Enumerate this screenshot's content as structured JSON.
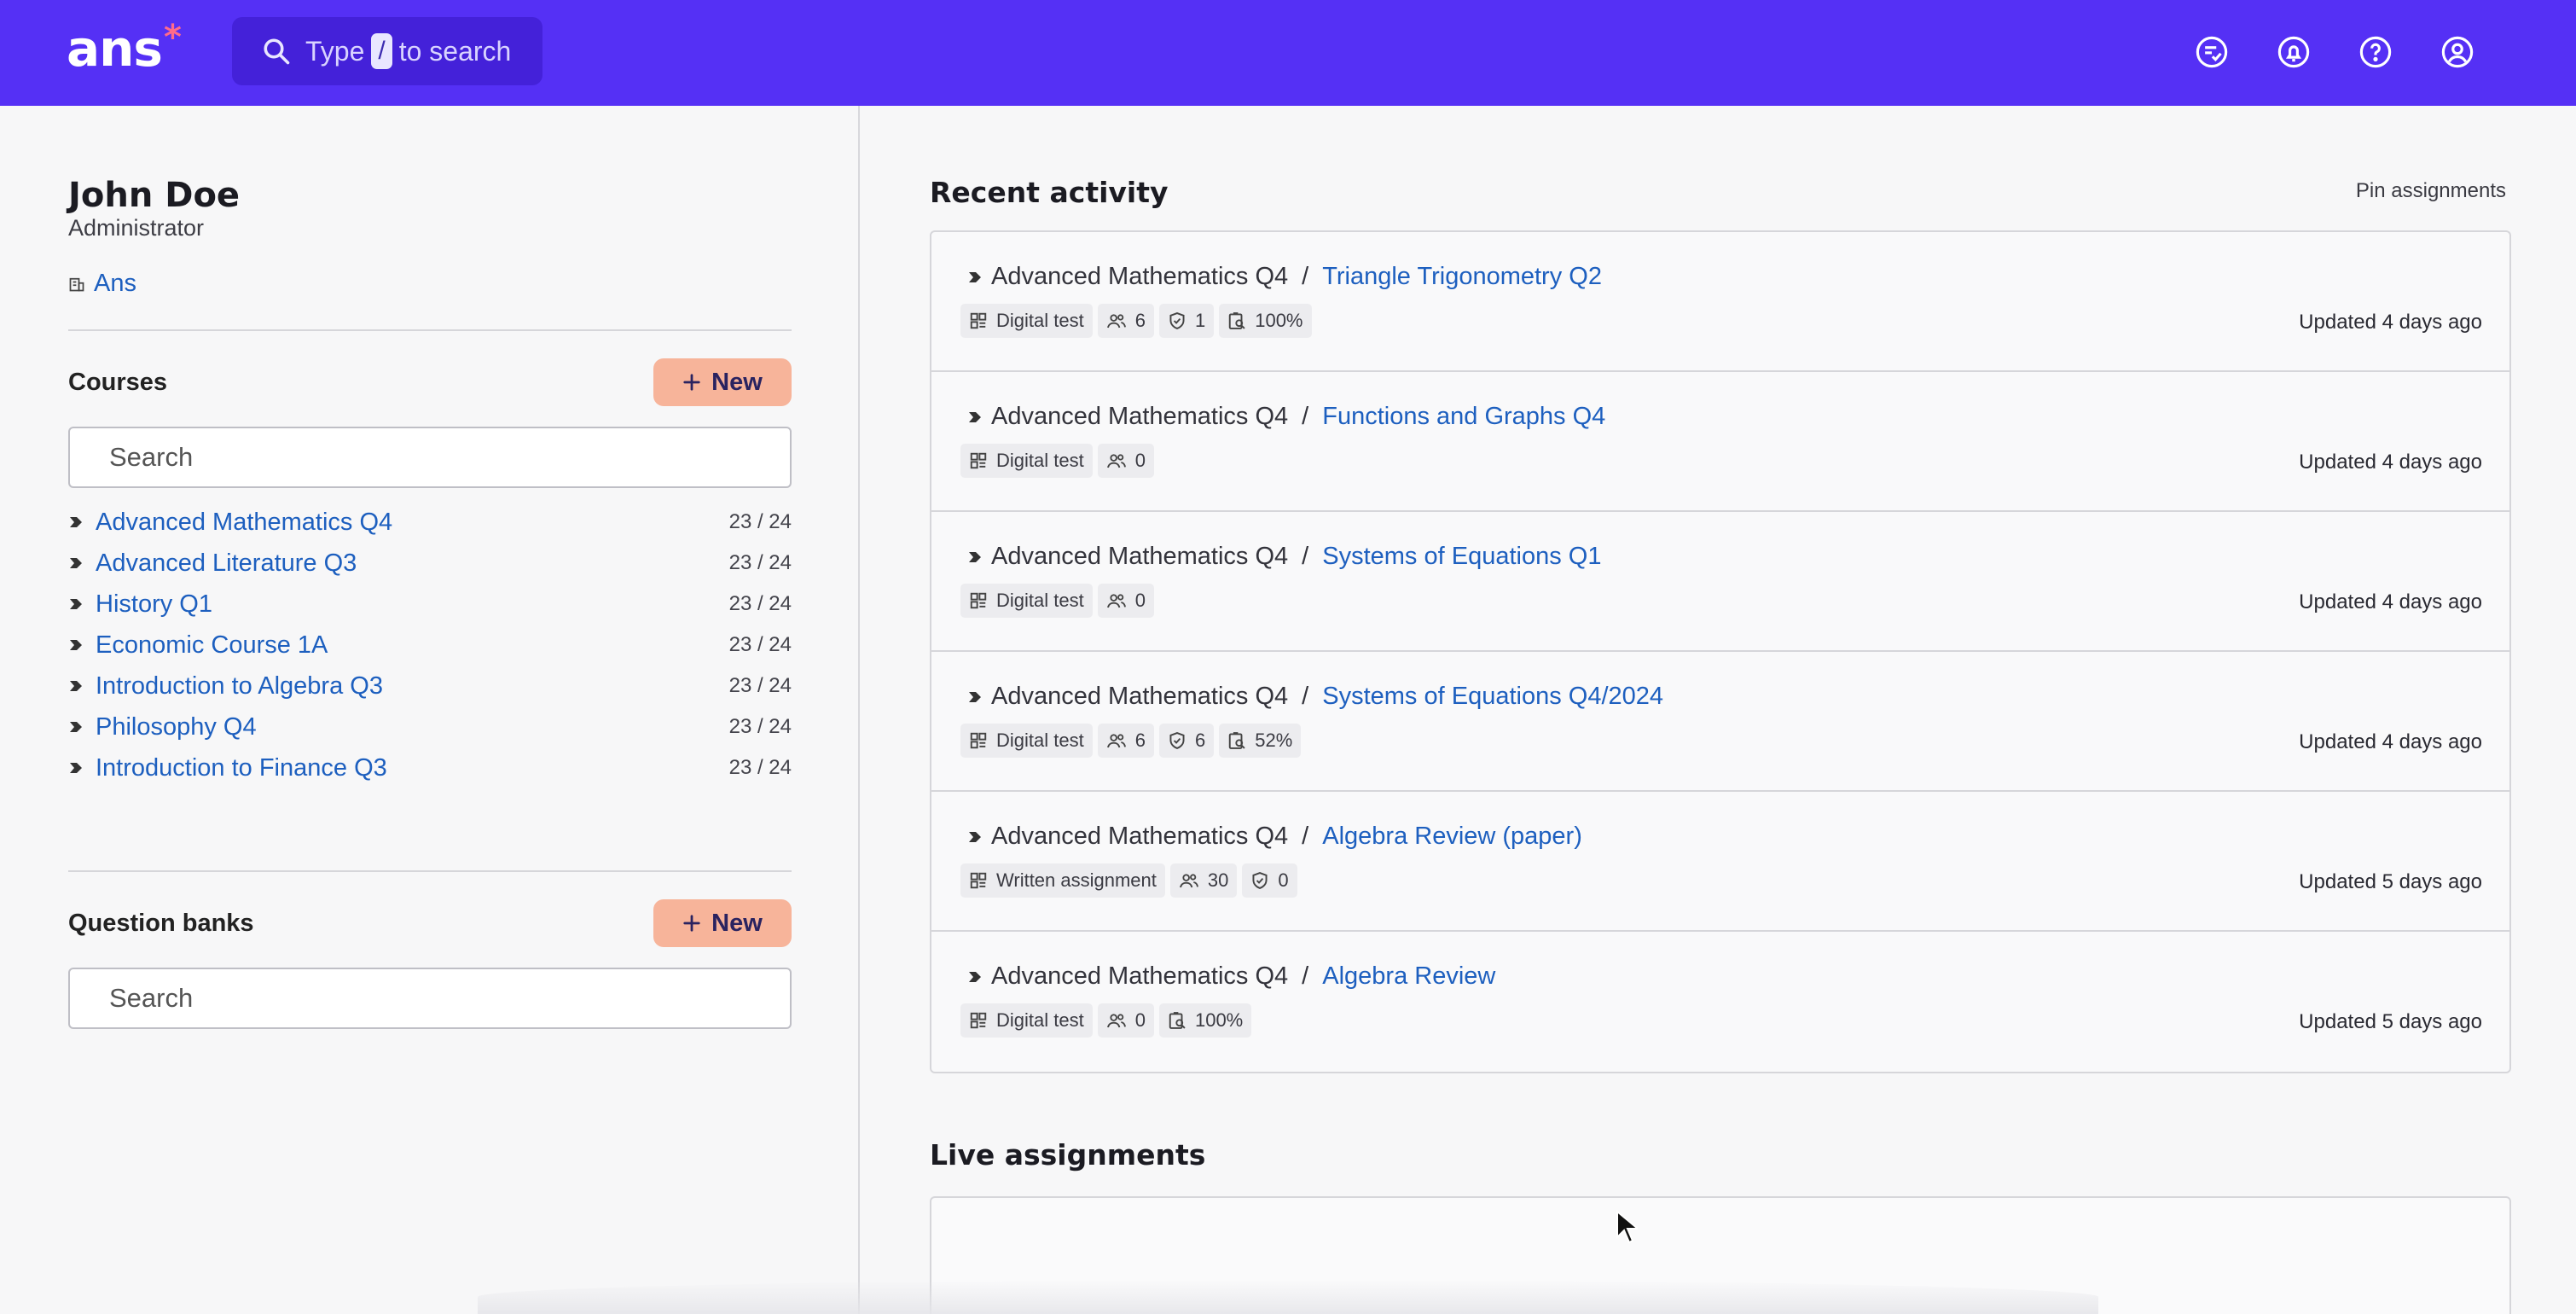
{
  "app": {
    "logo_text": "ans",
    "logo_mark": "*",
    "brand_color": "#5530f5"
  },
  "search": {
    "prefix": "Type",
    "key": "/",
    "suffix": "to search"
  },
  "header_icons": [
    "messages-icon",
    "notifications-icon",
    "help-icon",
    "account-icon"
  ],
  "user": {
    "name": "John Doe",
    "role": "Administrator",
    "organization": "Ans"
  },
  "courses": {
    "title": "Courses",
    "new_label": "New",
    "search_placeholder": "Search",
    "items": [
      {
        "name": "Advanced Mathematics Q4",
        "count": "23 / 24"
      },
      {
        "name": "Advanced Literature Q3",
        "count": "23 / 24"
      },
      {
        "name": "History Q1",
        "count": "23 / 24"
      },
      {
        "name": "Economic Course 1A",
        "count": "23 / 24"
      },
      {
        "name": "Introduction to Algebra Q3",
        "count": "23 / 24"
      },
      {
        "name": "Philosophy Q4",
        "count": "23 / 24"
      },
      {
        "name": "Introduction to Finance Q3",
        "count": "23 / 24"
      }
    ]
  },
  "question_banks": {
    "title": "Question banks",
    "new_label": "New",
    "search_placeholder": "Search"
  },
  "recent_activity": {
    "title": "Recent activity",
    "pin_label": "Pin assignments",
    "items": [
      {
        "course": "Advanced Mathematics Q4",
        "assignment": "Triangle Trigonometry Q2",
        "type": "Digital test",
        "students": "6",
        "submitted": "1",
        "reviewed": "100%",
        "updated": "Updated 4 days ago"
      },
      {
        "course": "Advanced Mathematics Q4",
        "assignment": "Functions and Graphs Q4",
        "type": "Digital test",
        "students": "0",
        "submitted": null,
        "reviewed": null,
        "updated": "Updated 4 days ago"
      },
      {
        "course": "Advanced Mathematics Q4",
        "assignment": "Systems of Equations Q1",
        "type": "Digital test",
        "students": "0",
        "submitted": null,
        "reviewed": null,
        "updated": "Updated 4 days ago"
      },
      {
        "course": "Advanced Mathematics Q4",
        "assignment": "Systems of Equations Q4/2024",
        "type": "Digital test",
        "students": "6",
        "submitted": "6",
        "reviewed": "52%",
        "updated": "Updated 4 days ago"
      },
      {
        "course": "Advanced Mathematics Q4",
        "assignment": "Algebra Review (paper)",
        "type": "Written assignment",
        "students": "30",
        "submitted": "0",
        "reviewed": null,
        "updated": "Updated 5 days ago"
      },
      {
        "course": "Advanced Mathematics Q4",
        "assignment": "Algebra Review",
        "type": "Digital test",
        "students": "0",
        "submitted": null,
        "reviewed": "100%",
        "updated": "Updated 5 days ago"
      }
    ]
  },
  "live_assignments": {
    "title": "Live assignments"
  }
}
